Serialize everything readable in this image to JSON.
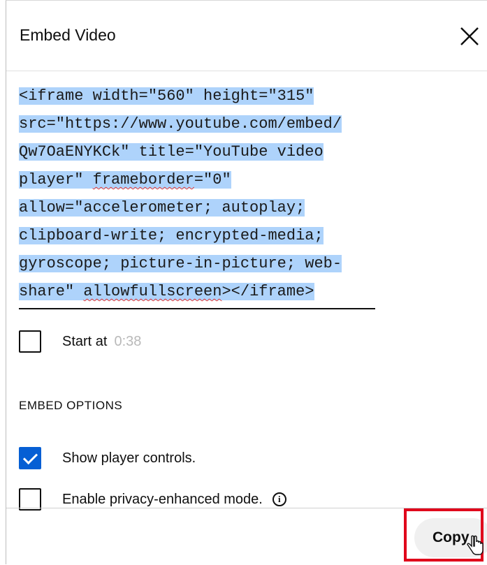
{
  "dialog": {
    "title": "Embed Video",
    "code_lines": [
      {
        "before": "<iframe width=\"560\" height=\"315\"",
        "spell": "",
        "after": ""
      },
      {
        "before": "src=\"https://www.youtube.com/embed/",
        "spell": "",
        "after": ""
      },
      {
        "before": "Qw7OaENYKCk\" title=\"YouTube video",
        "spell": "",
        "after": ""
      },
      {
        "before": "player\" ",
        "spell": "frameborder",
        "after": "=\"0\""
      },
      {
        "before": "allow=\"accelerometer; autoplay;",
        "spell": "",
        "after": ""
      },
      {
        "before": "clipboard-write; encrypted-media;",
        "spell": "",
        "after": ""
      },
      {
        "before": "gyroscope; picture-in-picture; web-",
        "spell": "",
        "after": ""
      },
      {
        "before": "share\" ",
        "spell": "allowfullscreen",
        "after": "></iframe>"
      }
    ],
    "start_at": {
      "label": "Start at",
      "time": "0:38",
      "checked": false
    },
    "embed_options": {
      "title": "EMBED OPTIONS",
      "show_controls": {
        "label": "Show player controls.",
        "checked": true
      },
      "privacy_mode": {
        "label": "Enable privacy-enhanced mode.",
        "checked": false,
        "info_icon": "info-circle-icon"
      }
    },
    "footer": {
      "copy_label": "Copy"
    },
    "colors": {
      "selection": "#aed3fb",
      "accent": "#065fd4",
      "highlight_box": "#e0001b"
    }
  }
}
